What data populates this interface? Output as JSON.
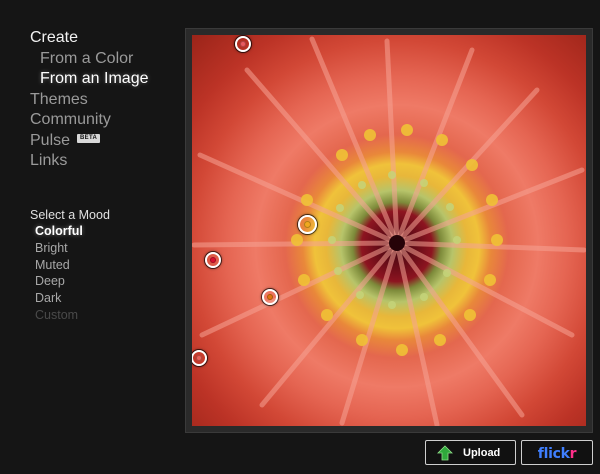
{
  "nav": {
    "create": "Create",
    "from_color": "From a Color",
    "from_image": "From an Image",
    "themes": "Themes",
    "community": "Community",
    "pulse": "Pulse",
    "pulse_badge": "BETA",
    "links": "Links"
  },
  "mood": {
    "title": "Select a Mood",
    "options": [
      "Colorful",
      "Bright",
      "Muted",
      "Deep",
      "Dark",
      "Custom"
    ],
    "selected": "Colorful"
  },
  "pickers": [
    {
      "color": "#e85a5f"
    },
    {
      "color": "#f0a81f"
    },
    {
      "color": "#d8102f"
    },
    {
      "color": "#e1740f"
    },
    {
      "color": "#e8625a"
    }
  ],
  "buttons": {
    "upload": "Upload",
    "flickr_fl": "flick",
    "flickr_r": "r"
  },
  "colors": {
    "background": "#141414",
    "upload_arrow": "#2fa83b",
    "flickr_blue": "#3f7fff",
    "flickr_pink": "#ff2f8a"
  }
}
